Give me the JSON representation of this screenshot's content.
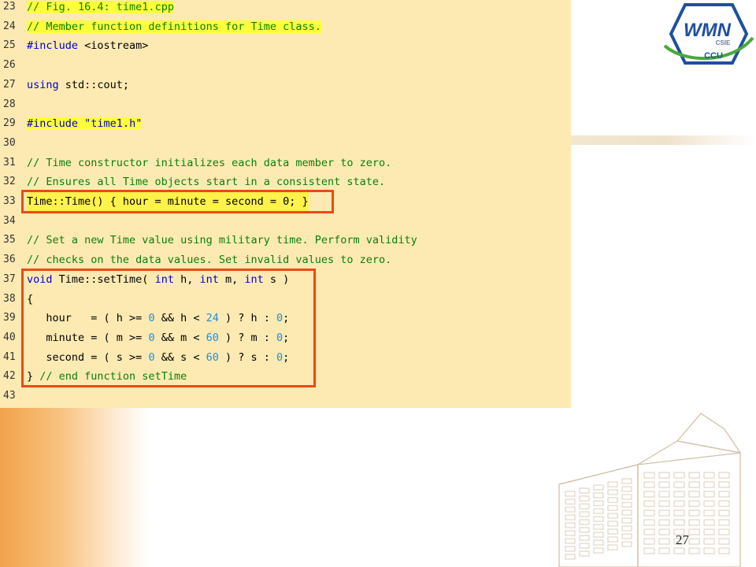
{
  "code_lines": [
    {
      "n": "23",
      "parts": [
        {
          "t": "// Fig. 16.4: ",
          "c": "cm hl"
        },
        {
          "t": "time1.cpp",
          "c": "cm hl"
        }
      ]
    },
    {
      "n": "24",
      "parts": [
        {
          "t": "// Member function definitions for Time class.",
          "c": "cm hl"
        }
      ]
    },
    {
      "n": "25",
      "parts": [
        {
          "t": "#include",
          "c": "kw"
        },
        {
          "t": " <iostream>",
          "c": ""
        }
      ]
    },
    {
      "n": "26",
      "parts": []
    },
    {
      "n": "27",
      "parts": [
        {
          "t": "using",
          "c": "kw"
        },
        {
          "t": " std::cout;",
          "c": ""
        }
      ]
    },
    {
      "n": "28",
      "parts": []
    },
    {
      "n": "29",
      "parts": [
        {
          "t": "#include",
          "c": "kw hl"
        },
        {
          "t": " ",
          "c": "hl"
        },
        {
          "t": "\"time1.h\"",
          "c": "str hl"
        }
      ]
    },
    {
      "n": "30",
      "parts": []
    },
    {
      "n": "31",
      "parts": [
        {
          "t": "// Time constructor initializes each data member to zero.",
          "c": "cm"
        }
      ]
    },
    {
      "n": "32",
      "parts": [
        {
          "t": "// Ensures all Time objects start in a consistent state.",
          "c": "cm"
        }
      ]
    },
    {
      "n": "33",
      "parts": [
        {
          "t": "Time::Time() { hour = minute = second = ",
          "c": ""
        },
        {
          "t": "0",
          "c": ""
        },
        {
          "t": "; }",
          "c": ""
        }
      ],
      "line_hl": true
    },
    {
      "n": "34",
      "parts": []
    },
    {
      "n": "35",
      "parts": [
        {
          "t": "// Set a new Time value using military time. Perform validity",
          "c": "cm"
        }
      ]
    },
    {
      "n": "36",
      "parts": [
        {
          "t": "// checks on the data values. Set invalid values to zero.",
          "c": "cm"
        }
      ]
    },
    {
      "n": "37",
      "parts": [
        {
          "t": "void",
          "c": "kw"
        },
        {
          "t": " Time::setTime( ",
          "c": ""
        },
        {
          "t": "int",
          "c": "kw"
        },
        {
          "t": " h, ",
          "c": ""
        },
        {
          "t": "int",
          "c": "kw"
        },
        {
          "t": " m, ",
          "c": ""
        },
        {
          "t": "int",
          "c": "kw"
        },
        {
          "t": " s )",
          "c": ""
        }
      ]
    },
    {
      "n": "38",
      "parts": [
        {
          "t": "{",
          "c": ""
        }
      ]
    },
    {
      "n": "39",
      "parts": [
        {
          "t": "   hour   = ( h >= ",
          "c": ""
        },
        {
          "t": "0",
          "c": "num"
        },
        {
          "t": " && h < ",
          "c": ""
        },
        {
          "t": "24",
          "c": "num"
        },
        {
          "t": " ) ? h : ",
          "c": ""
        },
        {
          "t": "0",
          "c": "num"
        },
        {
          "t": ";",
          "c": ""
        }
      ]
    },
    {
      "n": "40",
      "parts": [
        {
          "t": "   minute = ( m >= ",
          "c": ""
        },
        {
          "t": "0",
          "c": "num"
        },
        {
          "t": " && m < ",
          "c": ""
        },
        {
          "t": "60",
          "c": "num"
        },
        {
          "t": " ) ? m : ",
          "c": ""
        },
        {
          "t": "0",
          "c": "num"
        },
        {
          "t": ";",
          "c": ""
        }
      ]
    },
    {
      "n": "41",
      "parts": [
        {
          "t": "   second = ( s >= ",
          "c": ""
        },
        {
          "t": "0",
          "c": "num"
        },
        {
          "t": " && s < ",
          "c": ""
        },
        {
          "t": "60",
          "c": "num"
        },
        {
          "t": " ) ? s : ",
          "c": ""
        },
        {
          "t": "0",
          "c": "num"
        },
        {
          "t": ";",
          "c": ""
        }
      ]
    },
    {
      "n": "42",
      "parts": [
        {
          "t": "} ",
          "c": ""
        },
        {
          "t": "// end function setTime",
          "c": "cm"
        }
      ]
    },
    {
      "n": "43",
      "parts": []
    }
  ],
  "logo": {
    "main": "WMN",
    "sub": "CSIE",
    "bottom": "CCU"
  },
  "page_number": "27",
  "colors": {
    "panel": "#fdeab3",
    "highlight_box": "#ea4b12",
    "comment": "#0a7f0a",
    "keyword": "#0000cc",
    "number": "#1c8fe0"
  }
}
